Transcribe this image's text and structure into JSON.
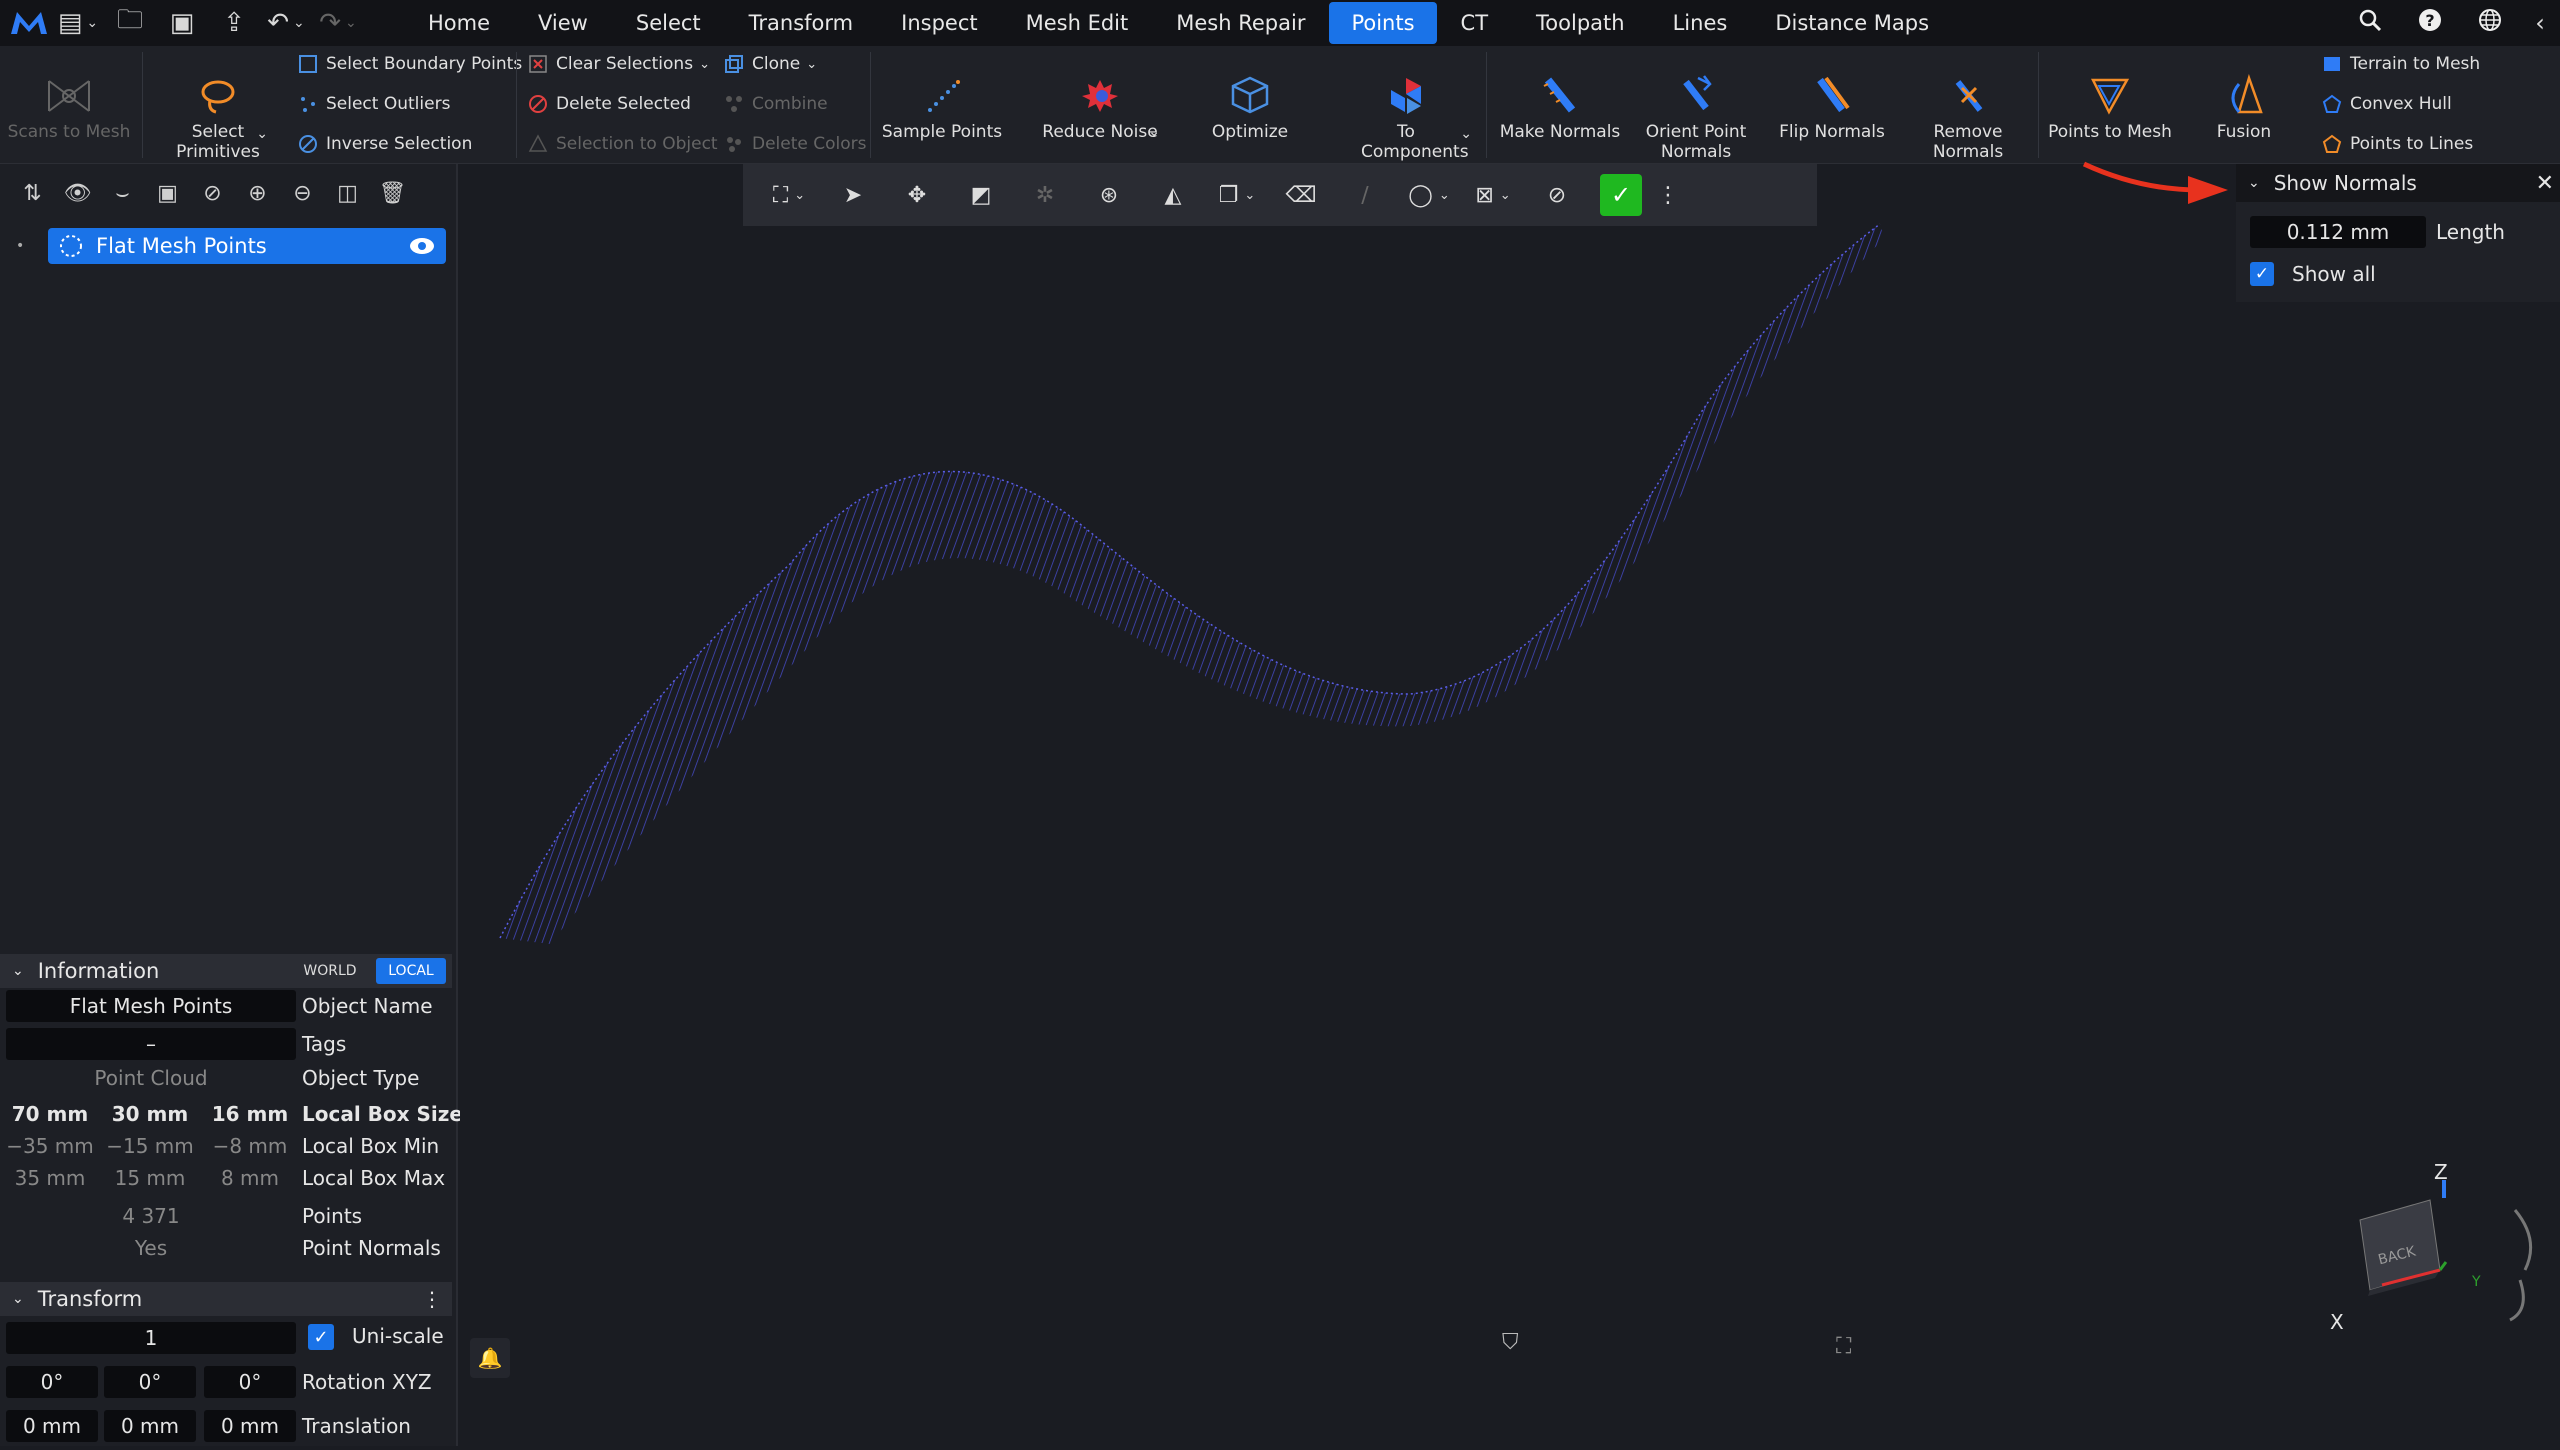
{
  "menu": {
    "tabs": [
      "Home",
      "View",
      "Select",
      "Transform",
      "Inspect",
      "Mesh Edit",
      "Mesh Repair",
      "Points",
      "CT",
      "Toolpath",
      "Lines",
      "Distance Maps"
    ],
    "active_tab": "Points"
  },
  "ribbon": {
    "scans_to_mesh": "Scans to Mesh",
    "select_primitives": "Select Primitives",
    "select_boundary_points": "Select Boundary Points",
    "select_outliers": "Select Outliers",
    "inverse_selection": "Inverse Selection",
    "clear_selections": "Clear Selections",
    "delete_selected": "Delete Selected",
    "selection_to_object": "Selection to Object",
    "clone": "Clone",
    "combine": "Combine",
    "delete_colors": "Delete Colors",
    "sample_points": "Sample Points",
    "reduce_noise": "Reduce Noise",
    "optimize": "Optimize",
    "to_components": "To Components",
    "make_normals": "Make Normals",
    "orient_point_normals": "Orient Point Normals",
    "flip_normals": "Flip Normals",
    "remove_normals": "Remove Normals",
    "points_to_mesh": "Points to Mesh",
    "fusion": "Fusion",
    "terrain_to_mesh": "Terrain to Mesh",
    "convex_hull": "Convex Hull",
    "points_to_lines": "Points to Lines"
  },
  "tree": {
    "item_label": "Flat Mesh Points"
  },
  "info": {
    "title": "Information",
    "world": "WORLD",
    "local": "LOCAL",
    "object_name_value": "Flat Mesh Points",
    "object_name_label": "Object Name",
    "tags_value": "–",
    "tags_label": "Tags",
    "object_type_value": "Point Cloud",
    "object_type_label": "Object Type",
    "box_size": [
      "70 mm",
      "30 mm",
      "16 mm"
    ],
    "box_size_label": "Local Box Size",
    "box_min": [
      "−35 mm",
      "−15 mm",
      "−8 mm"
    ],
    "box_min_label": "Local Box Min",
    "box_max": [
      "35 mm",
      "15 mm",
      "8 mm"
    ],
    "box_max_label": "Local Box Max",
    "points_value": "4 371",
    "points_label": "Points",
    "normals_value": "Yes",
    "normals_label": "Point Normals"
  },
  "transform": {
    "title": "Transform",
    "scale_value": "1",
    "uniscale_label": "Uni-scale",
    "rotation": [
      "0°",
      "0°",
      "0°"
    ],
    "rotation_label": "Rotation XYZ",
    "translation": [
      "0 mm",
      "0 mm",
      "0 mm"
    ],
    "translation_label": "Translation"
  },
  "show_normals": {
    "title": "Show Normals",
    "length_value": "0.112 mm",
    "length_label": "Length",
    "show_all_label": "Show all"
  },
  "viewcube": {
    "face": "BACK",
    "x": "X",
    "y": "Y",
    "z": "Z"
  },
  "colors": {
    "accent": "#1a73e8",
    "points": "#4a4fd8",
    "annotation_arrow": "#e8321e"
  }
}
